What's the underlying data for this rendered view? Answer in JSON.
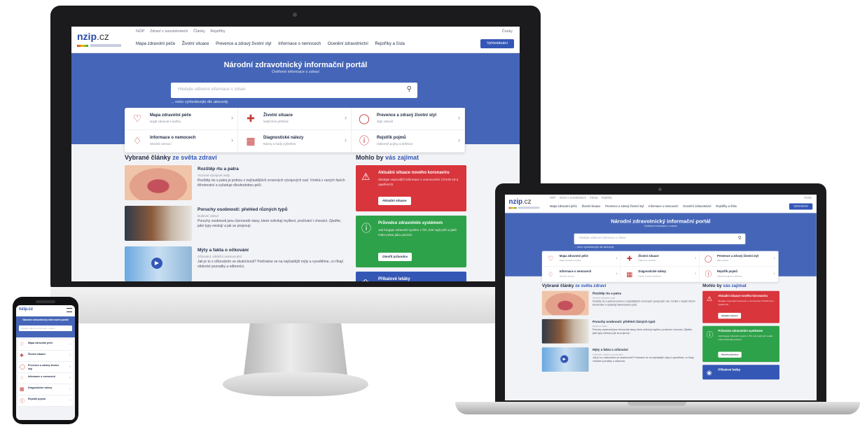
{
  "site": {
    "logo_name": "nzip",
    "logo_domain": ".cz",
    "top_links": [
      "NZIP",
      "Zdraví v souvislostech",
      "Články",
      "Rejstříky"
    ],
    "language": "Česky",
    "main_nav": [
      "Mapa zdravotní péče",
      "Životní situace",
      "Prevence a zdravý životní styl",
      "Informace o nemocech",
      "Ocenění zdravotnictví",
      "Rejstříky a čísla"
    ],
    "search_button": "Vyhledávání",
    "hero_title": "Národní zdravotnický informační portál",
    "hero_subtitle": "Ověřené informace o zdraví",
    "search_placeholder": "Hledejte odborné informace o zdraví",
    "alpha_link": "... nebo vyhledávejte dle abecedy",
    "cards": [
      {
        "title": "Mapa zdravotní péče",
        "sub": "Najdi zdravotní službu",
        "icon": "heart-hand-icon"
      },
      {
        "title": "Životní situace",
        "sub": "Nabízíme přehled",
        "icon": "syringe-icon"
      },
      {
        "title": "Prevence a zdravý životní styl",
        "sub": "Žijte zdravě",
        "icon": "apple-icon"
      },
      {
        "title": "Informace o nemocech",
        "sub": "Slovník nemocí",
        "icon": "tooth-icon"
      },
      {
        "title": "Diagnostické nálezy",
        "sub": "Názvy a kódy vyšetření",
        "icon": "calendar-icon"
      },
      {
        "title": "Rejstřík pojmů",
        "sub": "Odborné pojmy a definice",
        "icon": "info-bubble-icon"
      }
    ],
    "articles_title": "Vybrané články",
    "articles_title_hl": "ze světa zdraví",
    "articles": [
      {
        "title": "Rozštěp rtu a patra",
        "meta": "Vrozené vývojové vady",
        "desc": "Rozštěp rtu a patra je jednou z nejčastějších vrozených vývojových vad. Vzniká v raných fázích těhotenství a vyžaduje dlouhodobou péči."
      },
      {
        "title": "Poruchy osobnosti: přehled různých typů",
        "meta": "Duševní zdraví",
        "desc": "Poruchy osobnosti jsou různorodé stavy, které ovlivňují myšlení, prožívání i chování. Zjistěte, jaké typy existují a jak se projevují."
      },
      {
        "title": "Mýty a fakta o očkování",
        "meta": "Očkování, infekční onemocnění",
        "desc": "Jak je to s očkováním ve skutečnosti? Podíváme se na nejčastější mýty a vysvětlíme, co říkají vědecké poznatky a odborníci."
      }
    ],
    "side_title": "Mohlo by",
    "side_title_hl": "vás zajímat",
    "side_boxes": [
      {
        "title": "Aktuální situace nového koronaviru",
        "desc": "Sledujte nejnovější informace o onemocnění COVID-19 a opatřeních.",
        "button": "Aktuální situace",
        "icon": "warning-icon",
        "color": "#d8353c"
      },
      {
        "title": "Průvodce zdravotním systémem",
        "desc": "Jak funguje zdravotní systém v ČR, kde najít péči a jaká máte práva jako pacient.",
        "button": "Otevřít průvodce",
        "icon": "info-icon",
        "color": "#2ea24a"
      },
      {
        "title": "Příbalové letáky",
        "desc": "",
        "button": "",
        "icon": "pill-icon",
        "color": "#3457b6"
      }
    ],
    "mobile_items": [
      {
        "title": "Mapa zdravotní péče",
        "icon": "heart-hand-icon"
      },
      {
        "title": "Životní situace",
        "icon": "syringe-icon"
      },
      {
        "title": "Prevence a zdravý životní styl",
        "icon": "apple-icon"
      },
      {
        "title": "Informace o nemocech",
        "icon": "tooth-icon"
      },
      {
        "title": "Diagnostické nálezy",
        "icon": "calendar-icon"
      },
      {
        "title": "Rejstřík pojmů",
        "icon": "info-bubble-icon"
      }
    ]
  }
}
